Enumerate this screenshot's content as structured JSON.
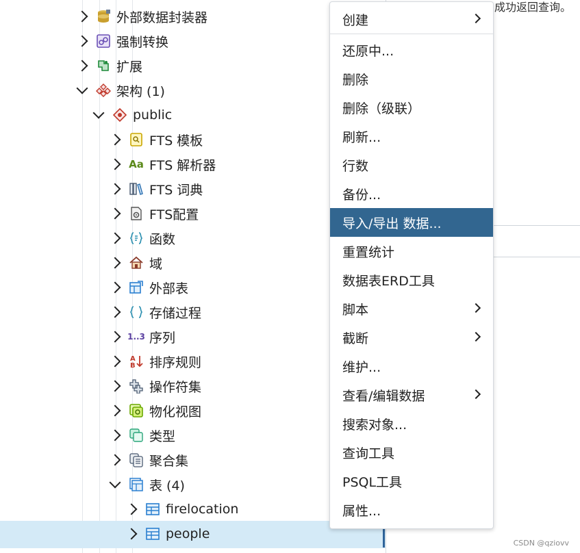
{
  "tree": {
    "items": [
      {
        "label": "外部数据封装器",
        "icon": "foreign-data-wrapper-icon",
        "expanded": false
      },
      {
        "label": "强制转换",
        "icon": "cast-icon",
        "expanded": false
      },
      {
        "label": "扩展",
        "icon": "extension-icon",
        "expanded": false
      },
      {
        "label": "架构 (1)",
        "icon": "schemas-icon",
        "expanded": true
      },
      {
        "label": "public",
        "icon": "schema-icon",
        "expanded": true
      },
      {
        "label": "FTS 模板",
        "icon": "fts-template-icon",
        "expanded": false
      },
      {
        "label": "FTS 解析器",
        "icon": "fts-parser-icon",
        "icon_text": "Aa",
        "expanded": false
      },
      {
        "label": "FTS 词典",
        "icon": "fts-dictionary-icon",
        "expanded": false
      },
      {
        "label": "FTS配置",
        "icon": "fts-configuration-icon",
        "expanded": false
      },
      {
        "label": "函数",
        "icon": "function-icon",
        "expanded": false
      },
      {
        "label": "域",
        "icon": "domain-icon",
        "expanded": false
      },
      {
        "label": "外部表",
        "icon": "foreign-table-icon",
        "expanded": false
      },
      {
        "label": "存储过程",
        "icon": "procedure-icon",
        "expanded": false
      },
      {
        "label": "序列",
        "icon": "sequence-icon",
        "icon_text": "1..3",
        "expanded": false
      },
      {
        "label": "排序规则",
        "icon": "collation-icon",
        "expanded": false
      },
      {
        "label": "操作符集",
        "icon": "operator-icon",
        "expanded": false
      },
      {
        "label": "物化视图",
        "icon": "materialized-view-icon",
        "expanded": false
      },
      {
        "label": "类型",
        "icon": "type-icon",
        "expanded": false
      },
      {
        "label": "聚合集",
        "icon": "aggregate-icon",
        "expanded": false
      },
      {
        "label": "表 (4)",
        "icon": "tables-icon",
        "expanded": true
      },
      {
        "label": "firelocation",
        "icon": "table-icon",
        "expanded": false
      },
      {
        "label": "people",
        "icon": "table-icon",
        "expanded": false,
        "selected": true
      }
    ]
  },
  "context_menu": {
    "items": [
      {
        "label": "创建",
        "submenu": true
      },
      {
        "label": "还原中..."
      },
      {
        "label": "删除"
      },
      {
        "label": "删除（级联）"
      },
      {
        "label": "刷新..."
      },
      {
        "label": "行数"
      },
      {
        "label": "备份..."
      },
      {
        "label": "导入/导出 数据...",
        "highlighted": true
      },
      {
        "label": "重置统计"
      },
      {
        "label": "数据表ERD工具"
      },
      {
        "label": "脚本",
        "submenu": true
      },
      {
        "label": "截断",
        "submenu": true
      },
      {
        "label": "维护..."
      },
      {
        "label": "查看/编辑数据",
        "submenu": true
      },
      {
        "label": "搜索对象..."
      },
      {
        "label": "查询工具"
      },
      {
        "label": "PSQL工具"
      },
      {
        "label": "属性..."
      }
    ]
  },
  "background_text": "成功返回查询。",
  "watermark": "CSDN @qziovv",
  "colors": {
    "menu_highlight": "#326690",
    "selected_row": "#d4eaf7",
    "selected_bar": "#2f6399"
  }
}
